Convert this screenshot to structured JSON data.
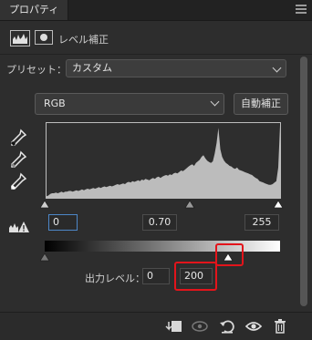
{
  "panel": {
    "tab_label": "プロパティ",
    "title": "レベル補正"
  },
  "preset": {
    "label": "プリセット：",
    "value": "カスタム"
  },
  "channel": {
    "value": "RGB",
    "auto_label": "自動補正"
  },
  "input_levels": {
    "black": "0",
    "gamma": "0.70",
    "white": "255"
  },
  "output_levels": {
    "label": "出力レベル：",
    "black": "0",
    "white": "200"
  },
  "histogram": {
    "levels": [
      2,
      3,
      5,
      6,
      6,
      7,
      6,
      7,
      8,
      7,
      8,
      8,
      9,
      9,
      8,
      9,
      10,
      9,
      10,
      11,
      10,
      11,
      12,
      11,
      12,
      13,
      12,
      13,
      14,
      13,
      14,
      15,
      14,
      15,
      16,
      15,
      16,
      17,
      18,
      17,
      18,
      19,
      18,
      20,
      21,
      20,
      22,
      21,
      22,
      23,
      22,
      24,
      23,
      25,
      24,
      23,
      25,
      26,
      25,
      27,
      28,
      26,
      28,
      29,
      30,
      29,
      31,
      30,
      32,
      33,
      32,
      34,
      36,
      35,
      37,
      39,
      41,
      43,
      44,
      42,
      46,
      48,
      50,
      54,
      56,
      52,
      49,
      47,
      46,
      48,
      58,
      72,
      92,
      64,
      54,
      49,
      46,
      44,
      42,
      41,
      39,
      38,
      40,
      37,
      36,
      35,
      34,
      33,
      32,
      31,
      30,
      28,
      26,
      25,
      22,
      21,
      20,
      19,
      18,
      17,
      17,
      18,
      20,
      22,
      40,
      96
    ]
  },
  "colors": {
    "highlight": "#e3141b",
    "focus": "#4d87c7"
  }
}
